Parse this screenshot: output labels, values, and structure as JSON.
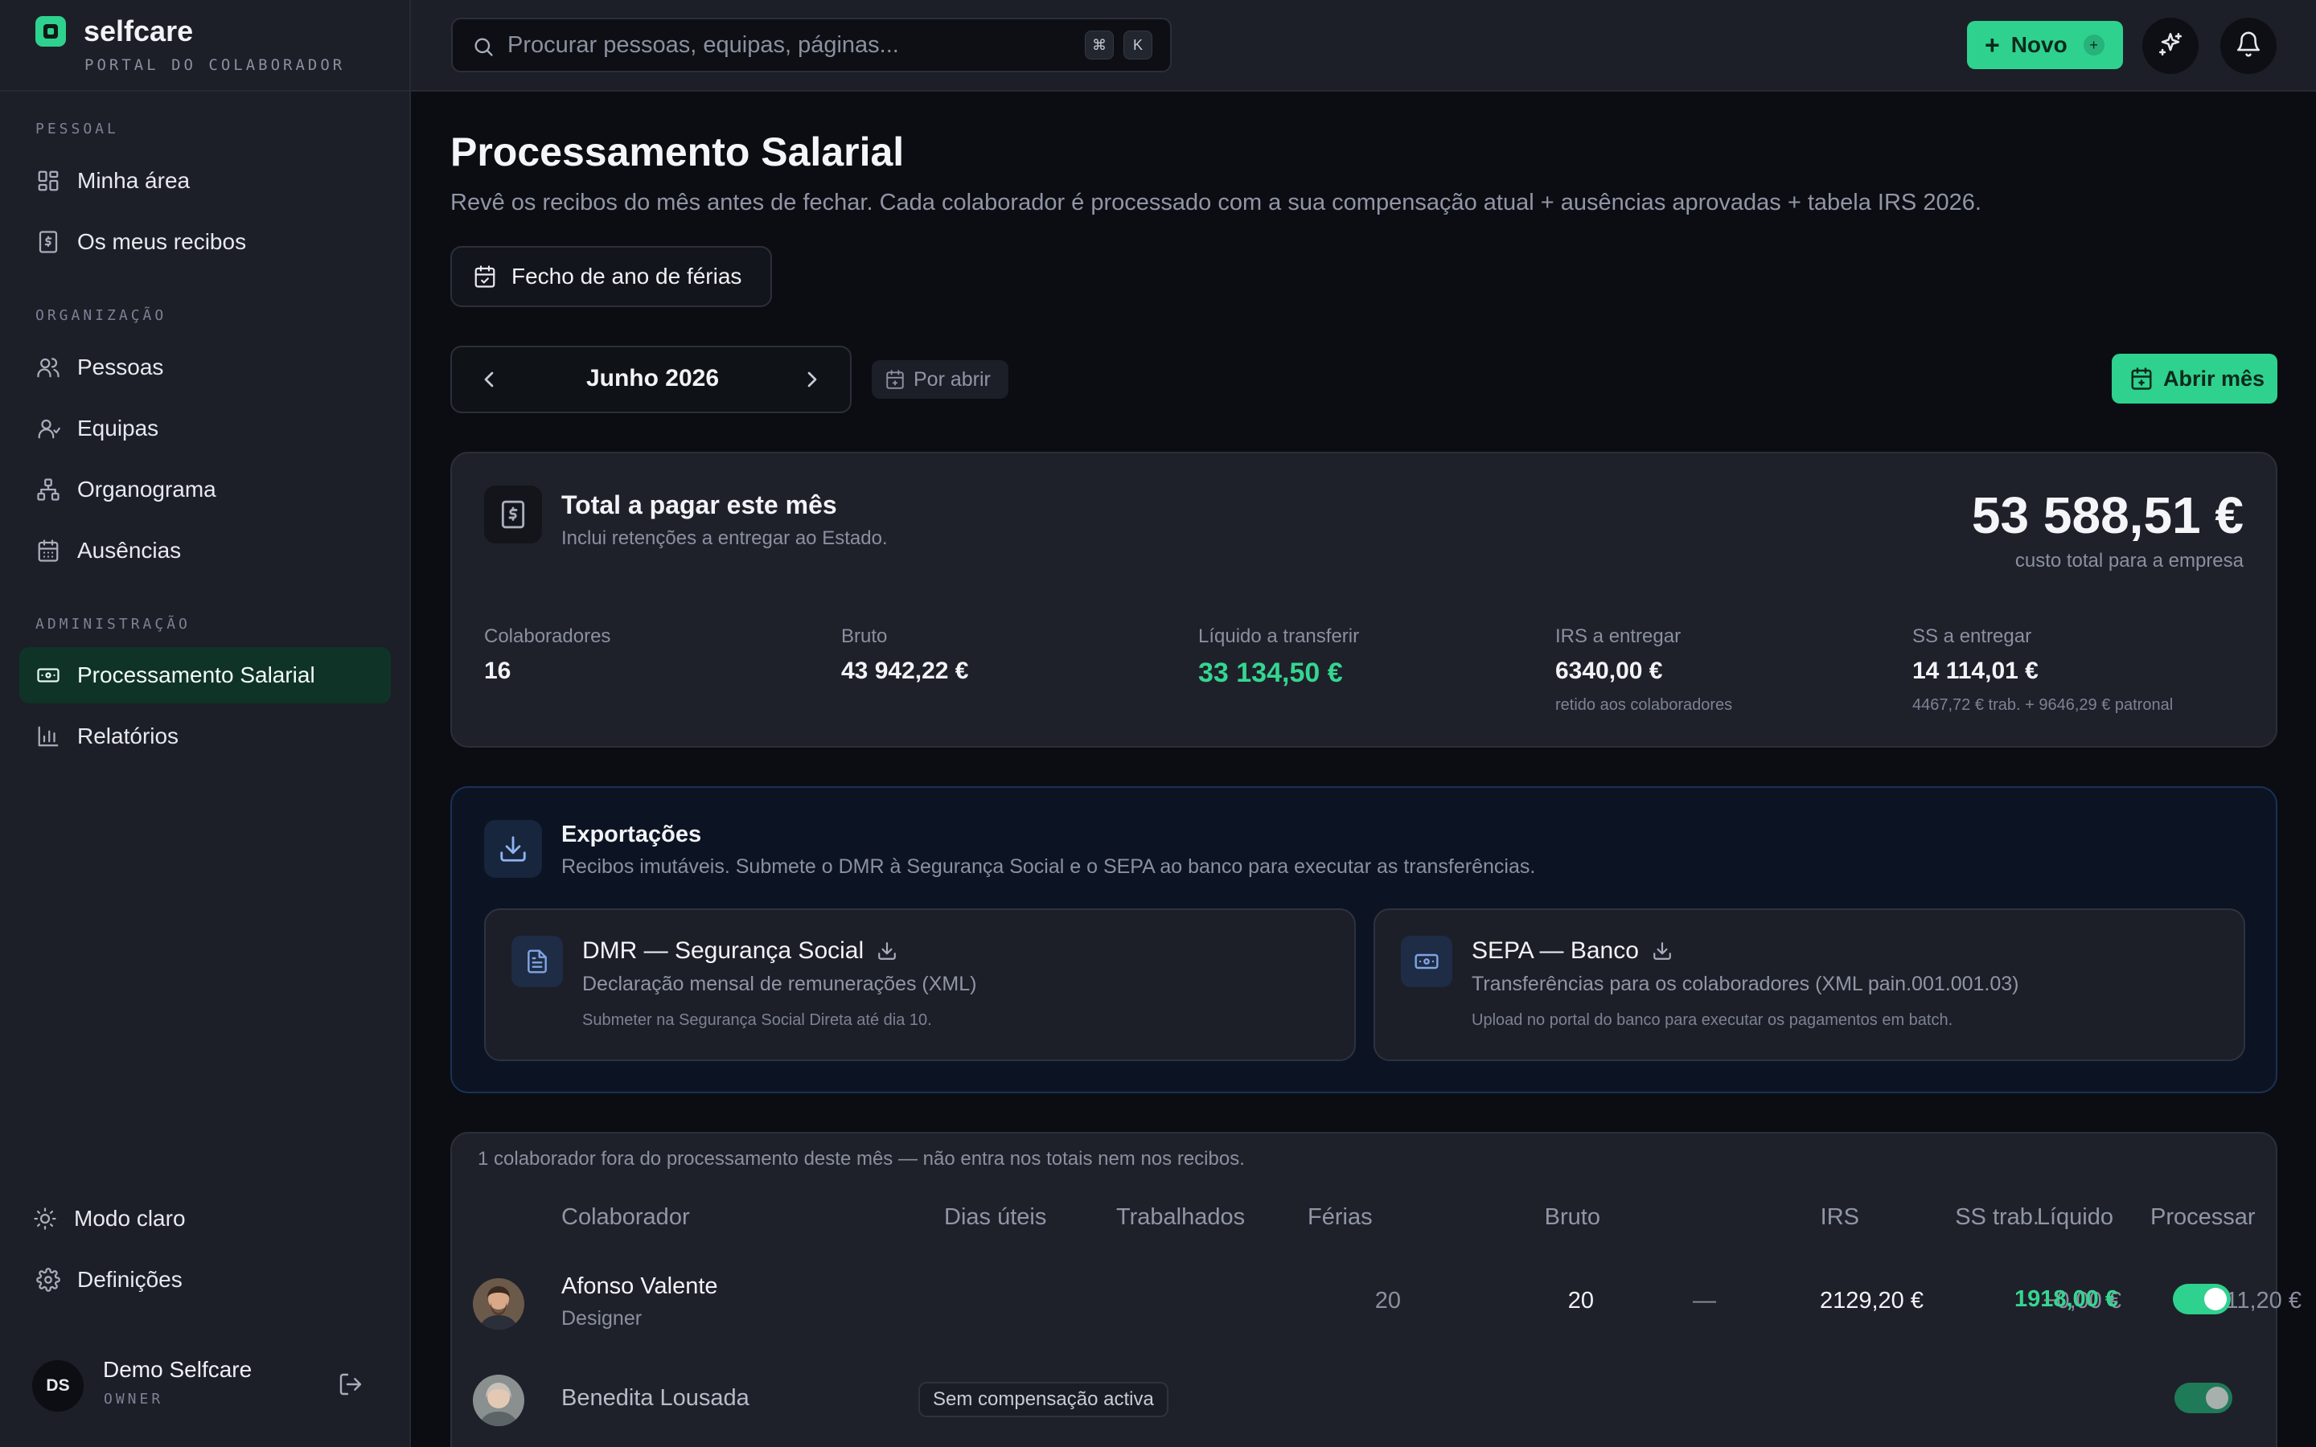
{
  "brand": {
    "name": "selfcare",
    "subtitle": "PORTAL DO COLABORADOR"
  },
  "sidebar": {
    "sections": [
      {
        "label": "PESSOAL",
        "items": [
          {
            "label": "Minha área",
            "icon": "grid-icon"
          },
          {
            "label": "Os meus recibos",
            "icon": "receipt-icon"
          }
        ]
      },
      {
        "label": "ORGANIZAÇÃO",
        "items": [
          {
            "label": "Pessoas",
            "icon": "users-icon"
          },
          {
            "label": "Equipas",
            "icon": "team-icon"
          },
          {
            "label": "Organograma",
            "icon": "org-chart-icon"
          },
          {
            "label": "Ausências",
            "icon": "calendar-icon"
          }
        ]
      },
      {
        "label": "ADMINISTRAÇÃO",
        "items": [
          {
            "label": "Processamento Salarial",
            "icon": "banknote-icon",
            "active": true
          },
          {
            "label": "Relatórios",
            "icon": "bar-chart-icon"
          }
        ]
      }
    ],
    "footer": [
      {
        "label": "Modo claro",
        "icon": "sun-icon"
      },
      {
        "label": "Definições",
        "icon": "gear-icon"
      }
    ],
    "user": {
      "initials": "DS",
      "name": "Demo Selfcare",
      "role": "OWNER"
    }
  },
  "topbar": {
    "search_placeholder": "Procurar pessoas, equipas, páginas...",
    "shortcut": [
      "⌘",
      "K"
    ],
    "new_label": "Novo",
    "accent": "#2fd18e"
  },
  "page": {
    "title": "Processamento Salarial",
    "subtitle": "Revê os recibos do mês antes de fechar. Cada colaborador é processado com a sua compensação atual + ausências aprovadas + tabela IRS 2026.",
    "vacation_button": "Fecho de ano de férias",
    "month": "Junho 2026",
    "status": "Por abrir",
    "open_month_button": "Abrir mês"
  },
  "summary": {
    "title": "Total a pagar este mês",
    "subtitle": "Inclui retenções a entregar ao Estado.",
    "total": "53 588,51 €",
    "total_note": "custo total para a empresa",
    "metrics": [
      {
        "label": "Colaboradores",
        "value": "16",
        "note": ""
      },
      {
        "label": "Bruto",
        "value": "43 942,22 €",
        "note": ""
      },
      {
        "label": "Líquido a transferir",
        "value": "33 134,50 €",
        "note": ""
      },
      {
        "label": "IRS a entregar",
        "value": "6340,00 €",
        "note": "retido aos colaboradores"
      },
      {
        "label": "SS a entregar",
        "value": "14 114,01 €",
        "note": "4467,72 € trab. + 9646,29 € patronal"
      }
    ]
  },
  "exports": {
    "title": "Exportações",
    "subtitle": "Recibos imutáveis. Submete o DMR à Segurança Social e o SEPA ao banco para executar as transferências.",
    "items": [
      {
        "title": "DMR — Segurança Social",
        "desc": "Declaração mensal de remunerações (XML)",
        "note": "Submeter na Segurança Social Direta até dia 10."
      },
      {
        "title": "SEPA — Banco",
        "desc": "Transferências para os colaboradores (XML pain.001.001.03)",
        "note": "Upload no portal do banco para executar os pagamentos em batch."
      }
    ]
  },
  "table": {
    "note": "1 colaborador fora do processamento deste mês — não entra nos totais nem nos recibos.",
    "columns": [
      "Colaborador",
      "Dias úteis",
      "Trabalhados",
      "Férias",
      "Bruto",
      "IRS",
      "SS trab.",
      "Líquido",
      "Processar"
    ],
    "rows": [
      {
        "name": "Afonso Valente",
        "role": "Designer",
        "dias_uteis": "20",
        "trabalhados": "20",
        "ferias": "—",
        "bruto": "2129,20 €",
        "irs": "−0,00 €",
        "ss": "−211,20 €",
        "liquido": "1918,00 €",
        "processar": true
      },
      {
        "name": "Benedita Lousada",
        "badge": "Sem compensação activa",
        "processar": true
      }
    ]
  }
}
